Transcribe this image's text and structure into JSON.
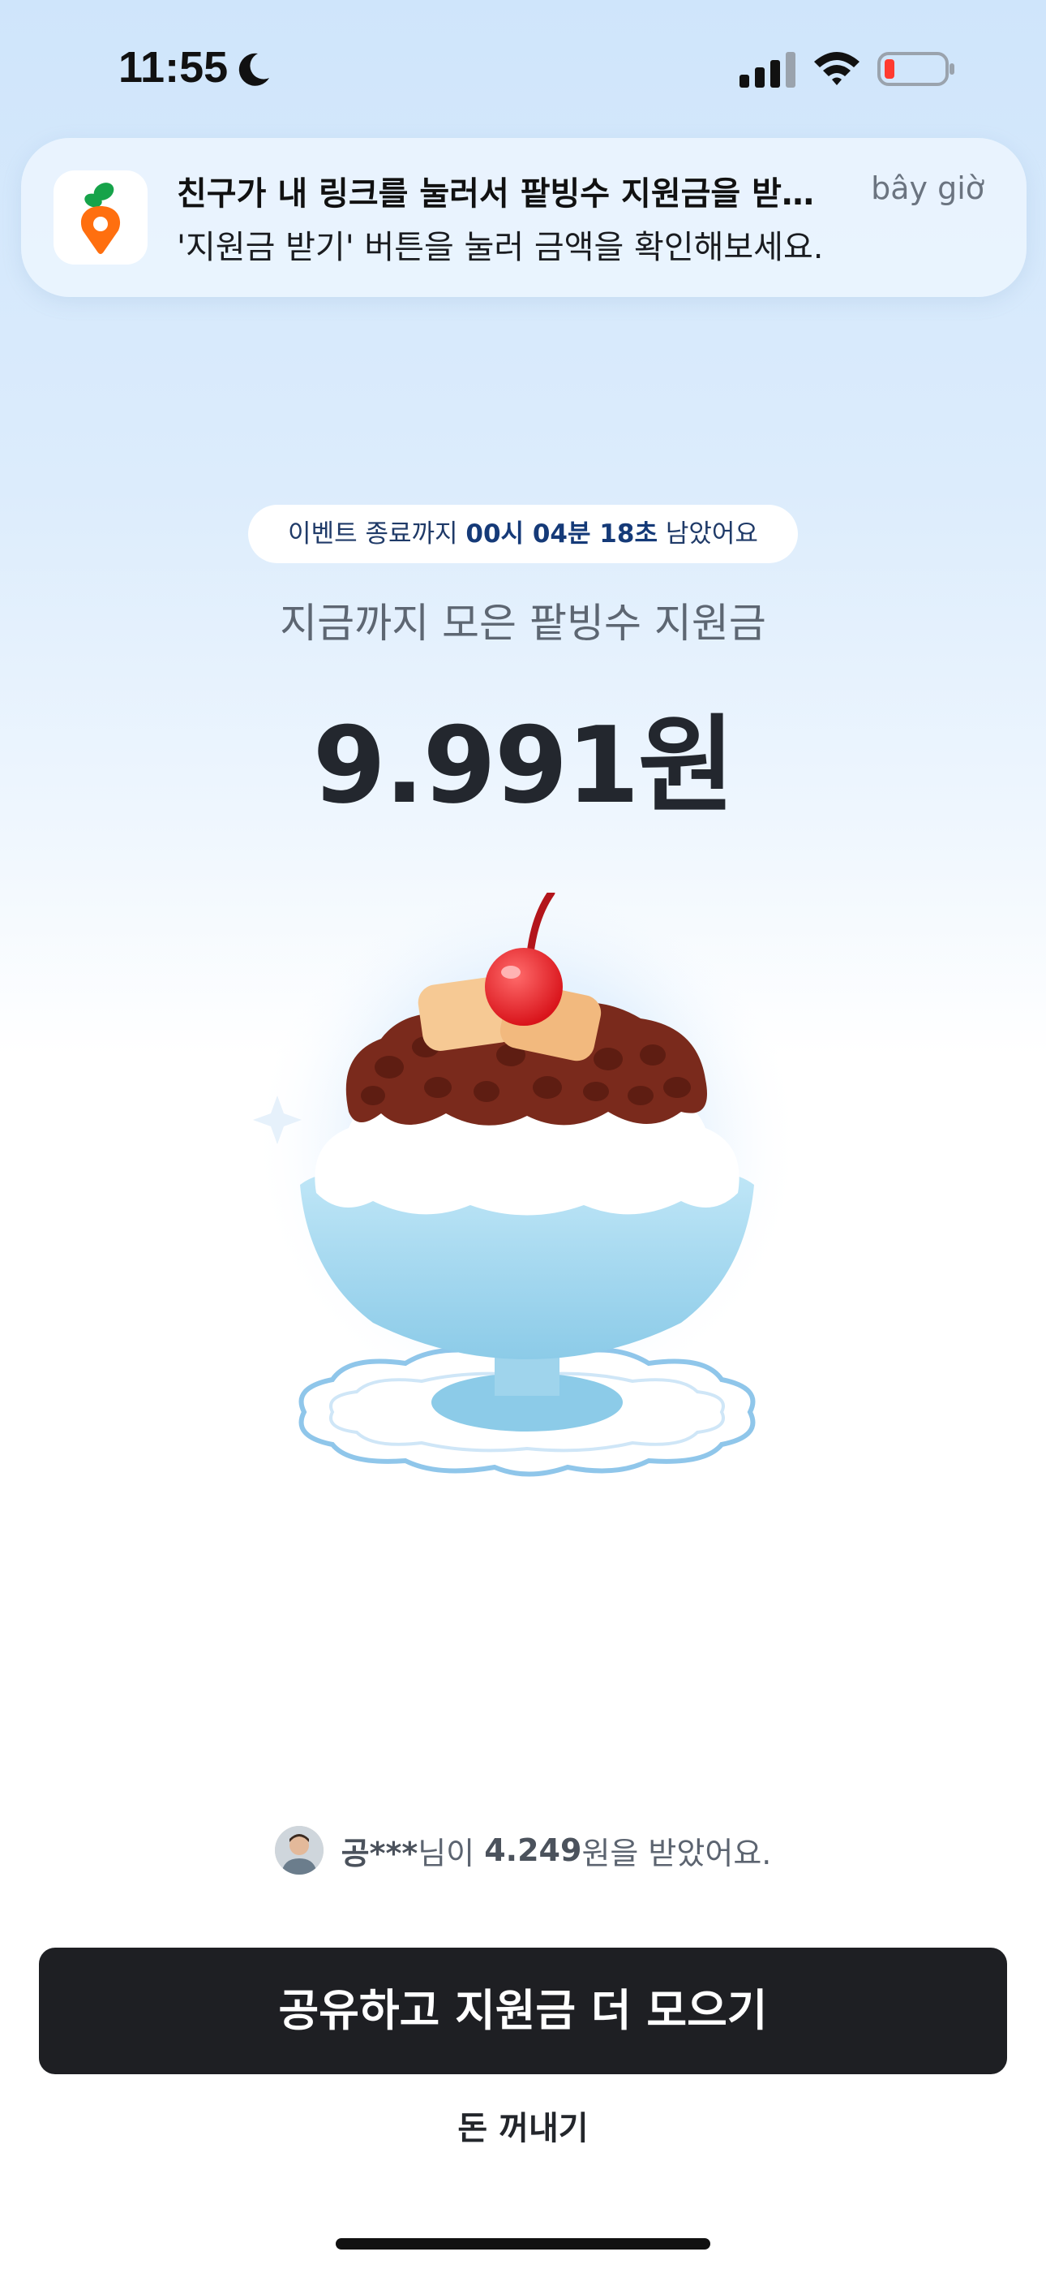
{
  "status_bar": {
    "time": "11:55"
  },
  "notification": {
    "title": "친구가 내 링크를 눌러서 팥빙수 지원금을 받…",
    "time": "bây giờ",
    "body": "'지원금 받기' 버튼을 눌러 금액을 확인해보세요."
  },
  "timer": {
    "prefix": "이벤트 종료까지",
    "remaining": "00시 04분 18초",
    "suffix": "남았어요"
  },
  "main": {
    "subtitle": "지금까지 모은 팥빙수 지원금",
    "amount": "9.991원"
  },
  "receiver": {
    "name": "공***",
    "middle": "님이",
    "amount": "4.249",
    "suffix": "원을 받았어요."
  },
  "actions": {
    "primary_label": "공유하고 지원금 더 모으기",
    "secondary_label": "돈 꺼내기"
  },
  "colors": {
    "primary_button": "#1e1f23",
    "background_top": "#cfe5fb",
    "timer_accent": "#153a78",
    "battery_low": "#ff3b30"
  }
}
